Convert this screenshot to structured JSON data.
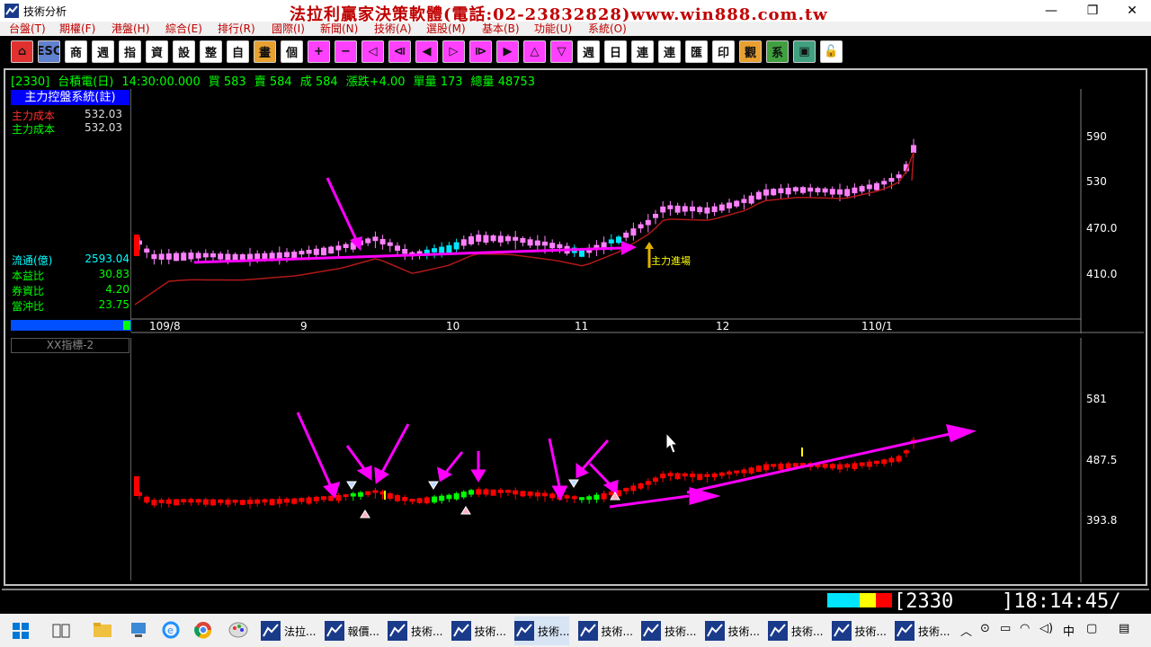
{
  "window": {
    "title": "技術分析",
    "banner": "法拉利贏家決策軟體(電話:02-23832828)www.win888.com.tw",
    "controls": [
      "—",
      "❐",
      "✕"
    ]
  },
  "menu": [
    "台盤(T)",
    "期權(F)",
    "港盤(H)",
    "綜合(E)",
    "排行(R)",
    "國際(I)",
    "新聞(N)",
    "技術(A)",
    "選股(M)",
    "基本(B)",
    "功能(U)",
    "系統(O)"
  ],
  "toolbar": [
    {
      "name": "home",
      "label": "⌂"
    },
    {
      "name": "esc",
      "label": "ESC"
    },
    {
      "name": "shang",
      "label": "商"
    },
    {
      "name": "report",
      "label": "週"
    },
    {
      "name": "index",
      "label": "指"
    },
    {
      "name": "zi",
      "label": "資"
    },
    {
      "name": "set",
      "label": "設"
    },
    {
      "name": "combo",
      "label": "整"
    },
    {
      "name": "self",
      "label": "自"
    },
    {
      "name": "draw",
      "label": "畫"
    },
    {
      "name": "grid",
      "label": "個"
    },
    {
      "name": "plus",
      "label": "+"
    },
    {
      "name": "minus",
      "label": "−"
    },
    {
      "name": "left",
      "label": "◁"
    },
    {
      "name": "left2",
      "label": "⧏"
    },
    {
      "name": "left3",
      "label": "◀"
    },
    {
      "name": "right",
      "label": "▷"
    },
    {
      "name": "right2",
      "label": "⧐"
    },
    {
      "name": "right3",
      "label": "▶"
    },
    {
      "name": "up",
      "label": "△"
    },
    {
      "name": "down",
      "label": "▽"
    },
    {
      "name": "zhou",
      "label": "週"
    },
    {
      "name": "ri",
      "label": "日"
    },
    {
      "name": "lian",
      "label": "連"
    },
    {
      "name": "lian2",
      "label": "連"
    },
    {
      "name": "hui",
      "label": "匯"
    },
    {
      "name": "print",
      "label": "印"
    },
    {
      "name": "guan",
      "label": "觀"
    },
    {
      "name": "xi",
      "label": "系"
    },
    {
      "name": "win",
      "label": "▣"
    },
    {
      "name": "lock",
      "label": "🔓"
    }
  ],
  "quote": {
    "code": "[2330]",
    "name": "台積電(日)",
    "time": "14:30:00.000",
    "buy_label": "買",
    "buy": "583",
    "sell_label": "賣",
    "sell": "584",
    "deal_label": "成",
    "deal": "584",
    "change_label": "漲跌",
    "change": "+4.00",
    "vol_label": "單量",
    "vol": "173",
    "total_label": "總量",
    "total": "48753"
  },
  "main_panel": {
    "system_title": "主力控盤系統(註)",
    "rows": [
      {
        "label": "主力成本",
        "value": "532.03",
        "color": "#ff3030"
      },
      {
        "label": "主力成本",
        "value": "532.03",
        "color": "#00ff00"
      }
    ],
    "stats": [
      {
        "label": "流通(億)",
        "value": "2593.04",
        "color": "#00ffff"
      },
      {
        "label": "本益比",
        "value": "30.83",
        "color": "#00ff00"
      },
      {
        "label": "券資比",
        "value": "4.20",
        "color": "#00ff00"
      },
      {
        "label": "當沖比",
        "value": "23.75",
        "color": "#00ff00"
      }
    ],
    "y_ticks": [
      "590",
      "530",
      "470.0",
      "410.0"
    ],
    "x_ticks": [
      "109/8",
      "9",
      "10",
      "11",
      "12",
      "110/1"
    ],
    "annotation": "主力進場"
  },
  "sub_panel": {
    "title": "XX指標-2",
    "y_ticks": [
      "581",
      "487.5",
      "393.8"
    ]
  },
  "status": {
    "code": "2330",
    "clock": "18:14:45"
  },
  "taskbar": {
    "items": [
      "法拉...",
      "報價...",
      "技術...",
      "技術...",
      "技術...",
      "技術...",
      "技術...",
      "技術...",
      "技術...",
      "技術...",
      "技術..."
    ],
    "ime": "中"
  },
  "colors": {
    "up": "#ff0000",
    "down": "#00ff00",
    "accent": "#ff00ff",
    "ma": "#b01818"
  }
}
